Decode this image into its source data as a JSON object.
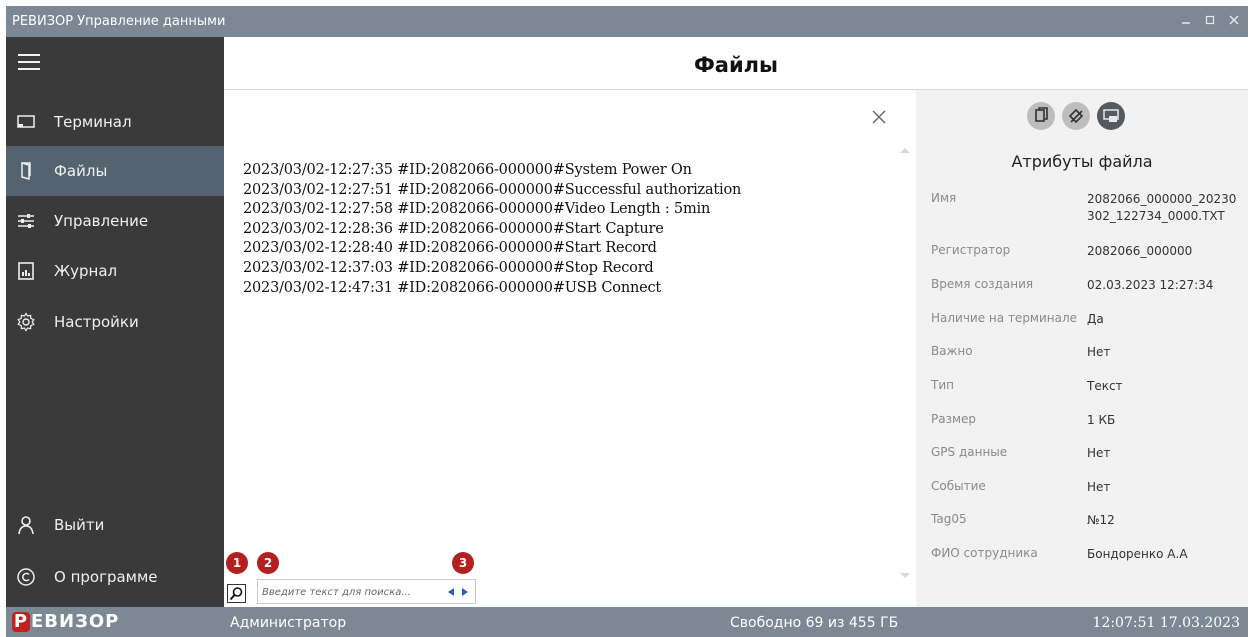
{
  "window": {
    "title": "РЕВИЗОР Управление данными",
    "controls": [
      "minimize-icon",
      "maximize-icon",
      "close-icon"
    ]
  },
  "sidebar": {
    "items": [
      {
        "label": "Терминал",
        "icon": "terminal-icon",
        "active": false
      },
      {
        "label": "Файлы",
        "icon": "files-icon",
        "active": true
      },
      {
        "label": "Управление",
        "icon": "sliders-icon",
        "active": false
      },
      {
        "label": "Журнал",
        "icon": "journal-icon",
        "active": false
      },
      {
        "label": "Настройки",
        "icon": "gear-icon",
        "active": false
      }
    ],
    "bottom_items": [
      {
        "label": "Выйти",
        "icon": "user-icon"
      },
      {
        "label": "О программе",
        "icon": "copyright-icon"
      }
    ]
  },
  "header": {
    "title": "Файлы"
  },
  "file_view": {
    "lines": [
      "2023/03/02-12:27:35 #ID:2082066-000000#System Power On",
      "2023/03/02-12:27:51 #ID:2082066-000000#Successful authorization",
      "2023/03/02-12:27:58 #ID:2082066-000000#Video Length : 5min",
      "2023/03/02-12:28:36 #ID:2082066-000000#Start Capture",
      "2023/03/02-12:28:40 #ID:2082066-000000#Start Record",
      "2023/03/02-12:37:03 #ID:2082066-000000#Stop Record",
      "2023/03/02-12:47:31 #ID:2082066-000000#USB Connect"
    ]
  },
  "search": {
    "placeholder": "Введите текст для поиска...",
    "badges": [
      "1",
      "2",
      "3"
    ]
  },
  "attributes": {
    "title": "Атрибуты файла",
    "toolbar_icons": [
      "copy-icon",
      "erase-tag-icon",
      "export-media-icon"
    ],
    "rows": [
      {
        "key": "Имя",
        "value": "2082066_000000_20230302_122734_0000.TXT"
      },
      {
        "key": "Регистратор",
        "value": "2082066_000000"
      },
      {
        "key": "Время создания",
        "value": "02.03.2023 12:27:34"
      },
      {
        "key": "Наличие на терминале",
        "value": "Да"
      },
      {
        "key": "Важно",
        "value": "Нет"
      },
      {
        "key": "Тип",
        "value": "Текст"
      },
      {
        "key": "Размер",
        "value": "1 КБ"
      },
      {
        "key": "GPS данные",
        "value": "Нет"
      },
      {
        "key": "Событие",
        "value": "Нет"
      },
      {
        "key": "Tag05",
        "value": "№12"
      },
      {
        "key": "ФИО сотрудника",
        "value": "Бондоренко А.А"
      }
    ]
  },
  "statusbar": {
    "logo_letter": "Р",
    "logo_rest": "ЕВИЗОР",
    "user": "Администратор",
    "free_space": "Свободно 69 из 455 ГБ",
    "datetime": "12:07:51 17.03.2023"
  },
  "colors": {
    "titlebar": "#7c8995",
    "sidebar": "#3a3a3a",
    "sidebar_active": "#556370",
    "badge": "#b3201f",
    "logo_red": "#c4201d"
  }
}
